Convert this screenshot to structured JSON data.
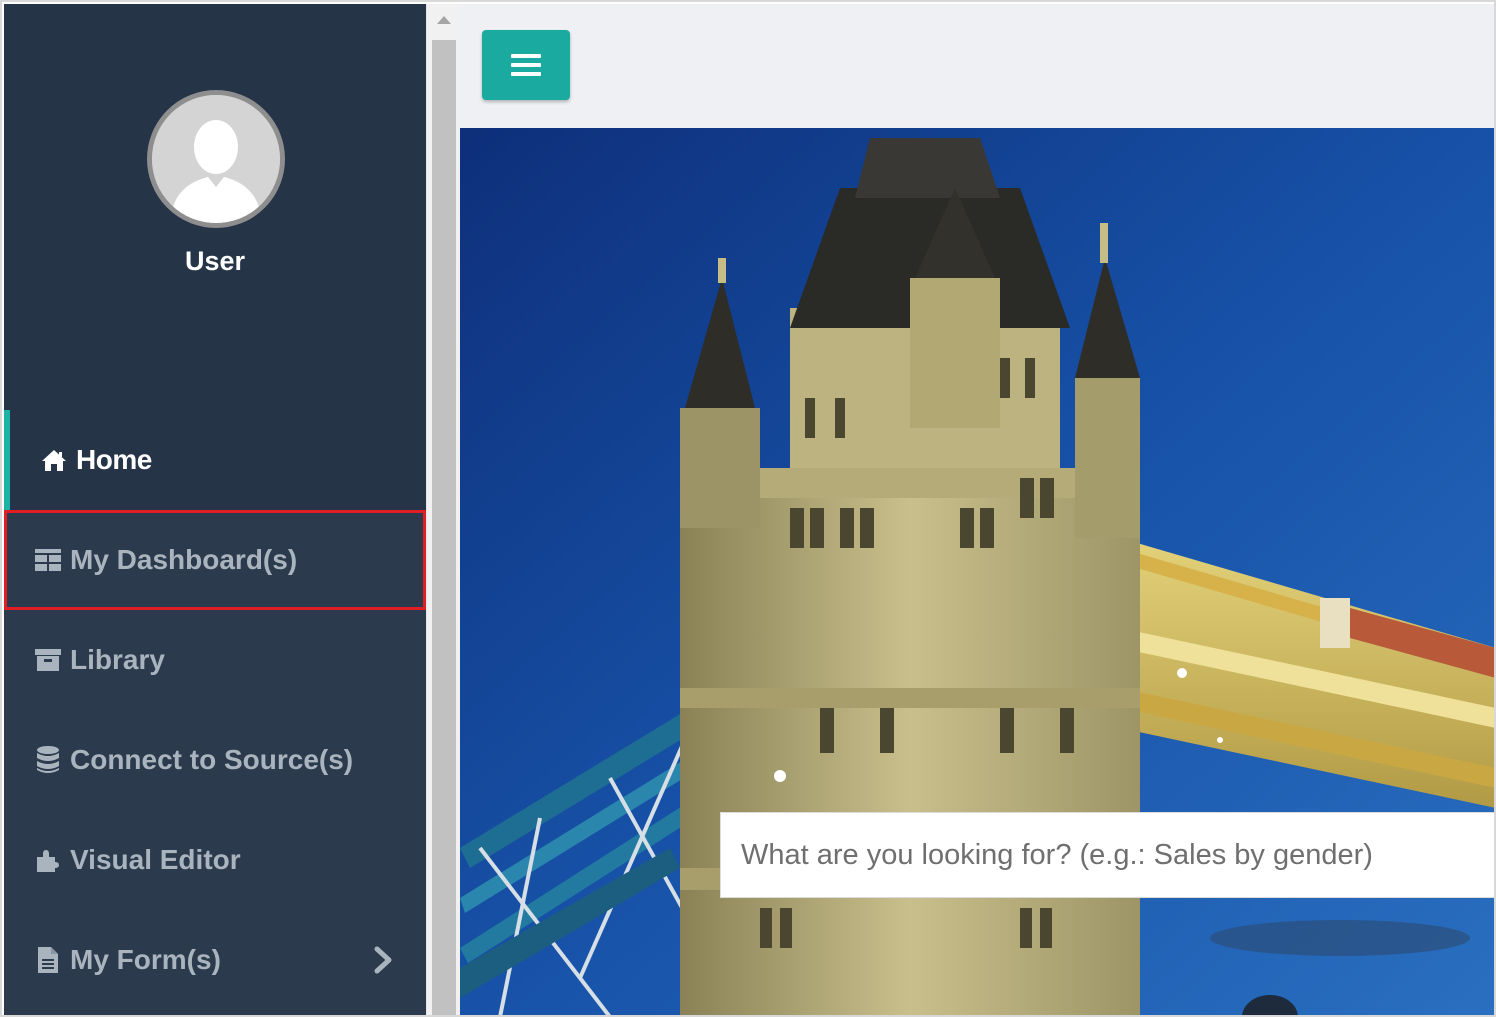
{
  "sidebar": {
    "user": {
      "name": "User",
      "avatar_icon": "user-avatar-icon"
    },
    "items": [
      {
        "label": "Home",
        "icon": "home-icon",
        "active": true
      },
      {
        "label": "My Dashboard(s)",
        "icon": "dashboard-grid-icon",
        "highlighted": true
      },
      {
        "label": "Library",
        "icon": "archive-box-icon"
      },
      {
        "label": "Connect to Source(s)",
        "icon": "database-icon"
      },
      {
        "label": "Visual Editor",
        "icon": "puzzle-icon"
      },
      {
        "label": "My Form(s)",
        "icon": "document-icon",
        "has_submenu": true
      }
    ]
  },
  "topbar": {
    "menu_icon": "hamburger-icon"
  },
  "search": {
    "placeholder": "What are you looking for? (e.g.: Sales by gender)"
  },
  "colors": {
    "sidebar_bg": "#2b3a4d",
    "profile_bg": "#253447",
    "accent": "#1aaaa0",
    "highlight_border": "#e01e26",
    "nav_text": "#aab4be"
  }
}
